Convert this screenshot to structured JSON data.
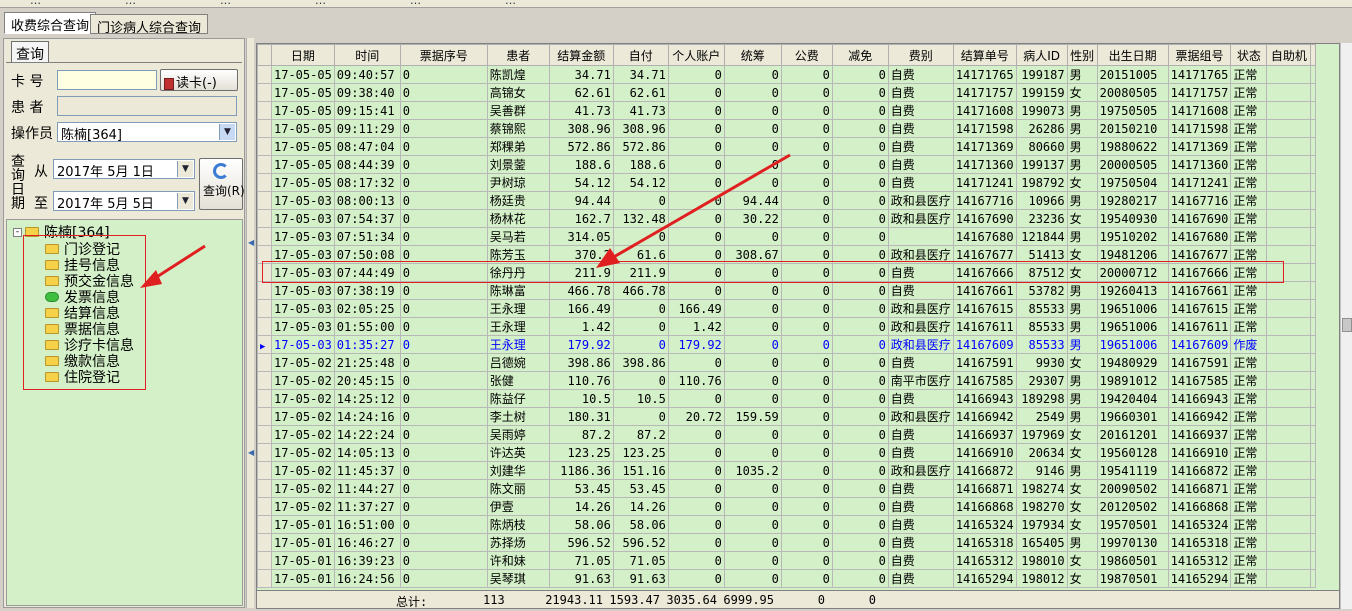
{
  "toolbar": {
    "items": [
      "…",
      "…",
      "…",
      "…",
      "…",
      "…"
    ]
  },
  "tabs": [
    {
      "label": "收费综合查询"
    },
    {
      "label": "门诊病人综合查询"
    }
  ],
  "query_panel": {
    "title": "查询",
    "card_label": "卡  号",
    "card_value": "",
    "read_card_button": "读卡(-)",
    "patient_label": "患  者",
    "patient_value": "",
    "operator_label": "操作员",
    "operator_value": "陈楠[364]",
    "date_label_1": "查询",
    "date_label_2": "日期",
    "from_label": "从",
    "from_date": "2017年 5月 1日",
    "to_label": "至",
    "to_date": "2017年 5月 5日",
    "query_button": "查询(R)"
  },
  "tree": {
    "root": "陈楠[364]",
    "children": [
      "门诊登记",
      "挂号信息",
      "预交金信息",
      "发票信息",
      "结算信息",
      "票据信息",
      "诊疗卡信息",
      "缴款信息",
      "住院登记"
    ]
  },
  "table": {
    "headers": [
      "日期",
      "时间",
      "票据序号",
      "患者",
      "结算金额",
      "自付",
      "个人账户",
      "统筹",
      "公费",
      "减免",
      "费别",
      "结算单号",
      "病人ID",
      "性别",
      "出生日期",
      "票据组号",
      "状态",
      "自助机"
    ],
    "rows": [
      [
        "17-05-05",
        "09:40:57",
        "0",
        "陈凯煌",
        "34.71",
        "34.71",
        "0",
        "0",
        "0",
        "0",
        "自费",
        "14171765",
        "199187",
        "男",
        "20151005",
        "14171765",
        "正常",
        ""
      ],
      [
        "17-05-05",
        "09:38:40",
        "0",
        "高锦女",
        "62.61",
        "62.61",
        "0",
        "0",
        "0",
        "0",
        "自费",
        "14171757",
        "199159",
        "女",
        "20080505",
        "14171757",
        "正常",
        ""
      ],
      [
        "17-05-05",
        "09:15:41",
        "0",
        "吴善群",
        "41.73",
        "41.73",
        "0",
        "0",
        "0",
        "0",
        "自费",
        "14171608",
        "199073",
        "男",
        "19750505",
        "14171608",
        "正常",
        ""
      ],
      [
        "17-05-05",
        "09:11:29",
        "0",
        "蔡锦熙",
        "308.96",
        "308.96",
        "0",
        "0",
        "0",
        "0",
        "自费",
        "14171598",
        "26286",
        "男",
        "20150210",
        "14171598",
        "正常",
        ""
      ],
      [
        "17-05-05",
        "08:47:04",
        "0",
        "郑稞弟",
        "572.86",
        "572.86",
        "0",
        "0",
        "0",
        "0",
        "自费",
        "14171369",
        "80660",
        "男",
        "19880622",
        "14171369",
        "正常",
        ""
      ],
      [
        "17-05-05",
        "08:44:39",
        "0",
        "刘景蓥",
        "188.6",
        "188.6",
        "0",
        "0",
        "0",
        "0",
        "自费",
        "14171360",
        "199137",
        "男",
        "20000505",
        "14171360",
        "正常",
        ""
      ],
      [
        "17-05-05",
        "08:17:32",
        "0",
        "尹树琼",
        "54.12",
        "54.12",
        "0",
        "0",
        "0",
        "0",
        "自费",
        "14171241",
        "198792",
        "女",
        "19750504",
        "14171241",
        "正常",
        ""
      ],
      [
        "17-05-03",
        "08:00:13",
        "0",
        "杨廷贵",
        "94.44",
        "0",
        "0",
        "94.44",
        "0",
        "0",
        "政和县医疗",
        "14167716",
        "10966",
        "男",
        "19280217",
        "14167716",
        "正常",
        ""
      ],
      [
        "17-05-03",
        "07:54:37",
        "0",
        "杨林花",
        "162.7",
        "132.48",
        "0",
        "30.22",
        "0",
        "0",
        "政和县医疗",
        "14167690",
        "23236",
        "女",
        "19540930",
        "14167690",
        "正常",
        ""
      ],
      [
        "17-05-03",
        "07:51:34",
        "0",
        "吴马若",
        "314.05",
        "0",
        "0",
        "0",
        "0",
        "0",
        "",
        "14167680",
        "121844",
        "男",
        "19510202",
        "14167680",
        "正常",
        ""
      ],
      [
        "17-05-03",
        "07:50:08",
        "0",
        "陈芳玉",
        "370.2",
        "61.6",
        "0",
        "308.67",
        "0",
        "0",
        "政和县医疗",
        "14167677",
        "51413",
        "女",
        "19481206",
        "14167677",
        "正常",
        ""
      ],
      [
        "17-05-03",
        "07:44:49",
        "0",
        "徐丹丹",
        "211.9",
        "211.9",
        "0",
        "0",
        "0",
        "0",
        "自费",
        "14167666",
        "87512",
        "女",
        "20000712",
        "14167666",
        "正常",
        ""
      ],
      [
        "17-05-03",
        "07:38:19",
        "0",
        "陈琳富",
        "466.78",
        "466.78",
        "0",
        "0",
        "0",
        "0",
        "自费",
        "14167661",
        "53782",
        "男",
        "19260413",
        "14167661",
        "正常",
        ""
      ],
      [
        "17-05-03",
        "02:05:25",
        "0",
        "王永理",
        "166.49",
        "0",
        "166.49",
        "0",
        "0",
        "0",
        "政和县医疗",
        "14167615",
        "85533",
        "男",
        "19651006",
        "14167615",
        "正常",
        ""
      ],
      [
        "17-05-03",
        "01:55:00",
        "0",
        "王永理",
        "1.42",
        "0",
        "1.42",
        "0",
        "0",
        "0",
        "政和县医疗",
        "14167611",
        "85533",
        "男",
        "19651006",
        "14167611",
        "正常",
        ""
      ],
      [
        "17-05-03",
        "01:35:27",
        "0",
        "王永理",
        "179.92",
        "0",
        "179.92",
        "0",
        "0",
        "0",
        "政和县医疗",
        "14167609",
        "85533",
        "男",
        "19651006",
        "14167609",
        "作废",
        ""
      ],
      [
        "17-05-02",
        "21:25:48",
        "0",
        "吕德婉",
        "398.86",
        "398.86",
        "0",
        "0",
        "0",
        "0",
        "自费",
        "14167591",
        "9930",
        "女",
        "19480929",
        "14167591",
        "正常",
        ""
      ],
      [
        "17-05-02",
        "20:45:15",
        "0",
        "张健",
        "110.76",
        "0",
        "110.76",
        "0",
        "0",
        "0",
        "南平市医疗",
        "14167585",
        "29307",
        "男",
        "19891012",
        "14167585",
        "正常",
        ""
      ],
      [
        "17-05-02",
        "14:25:12",
        "0",
        "陈益仔",
        "10.5",
        "10.5",
        "0",
        "0",
        "0",
        "0",
        "自费",
        "14166943",
        "189298",
        "男",
        "19420404",
        "14166943",
        "正常",
        ""
      ],
      [
        "17-05-02",
        "14:24:16",
        "0",
        "李土树",
        "180.31",
        "0",
        "20.72",
        "159.59",
        "0",
        "0",
        "政和县医疗",
        "14166942",
        "2549",
        "男",
        "19660301",
        "14166942",
        "正常",
        ""
      ],
      [
        "17-05-02",
        "14:22:24",
        "0",
        "吴雨婷",
        "87.2",
        "87.2",
        "0",
        "0",
        "0",
        "0",
        "自费",
        "14166937",
        "197969",
        "女",
        "20161201",
        "14166937",
        "正常",
        ""
      ],
      [
        "17-05-02",
        "14:05:13",
        "0",
        "许达英",
        "123.25",
        "123.25",
        "0",
        "0",
        "0",
        "0",
        "自费",
        "14166910",
        "20634",
        "女",
        "19560128",
        "14166910",
        "正常",
        ""
      ],
      [
        "17-05-02",
        "11:45:37",
        "0",
        "刘建华",
        "1186.36",
        "151.16",
        "0",
        "1035.2",
        "0",
        "0",
        "政和县医疗",
        "14166872",
        "9146",
        "男",
        "19541119",
        "14166872",
        "正常",
        ""
      ],
      [
        "17-05-02",
        "11:44:27",
        "0",
        "陈文丽",
        "53.45",
        "53.45",
        "0",
        "0",
        "0",
        "0",
        "自费",
        "14166871",
        "198274",
        "女",
        "20090502",
        "14166871",
        "正常",
        ""
      ],
      [
        "17-05-02",
        "11:37:27",
        "0",
        "伊壹",
        "14.26",
        "14.26",
        "0",
        "0",
        "0",
        "0",
        "自费",
        "14166868",
        "198270",
        "女",
        "20120502",
        "14166868",
        "正常",
        ""
      ],
      [
        "17-05-01",
        "16:51:00",
        "0",
        "陈炳枝",
        "58.06",
        "58.06",
        "0",
        "0",
        "0",
        "0",
        "自费",
        "14165324",
        "197934",
        "女",
        "19570501",
        "14165324",
        "正常",
        ""
      ],
      [
        "17-05-01",
        "16:46:27",
        "0",
        "苏择炀",
        "596.52",
        "596.52",
        "0",
        "0",
        "0",
        "0",
        "自费",
        "14165318",
        "165405",
        "男",
        "19970130",
        "14165318",
        "正常",
        ""
      ],
      [
        "17-05-01",
        "16:39:23",
        "0",
        "许和妹",
        "71.05",
        "71.05",
        "0",
        "0",
        "0",
        "0",
        "自费",
        "14165312",
        "198010",
        "女",
        "19860501",
        "14165312",
        "正常",
        ""
      ],
      [
        "17-05-01",
        "16:24:56",
        "0",
        "吴琴琪",
        "91.63",
        "91.63",
        "0",
        "0",
        "0",
        "0",
        "自费",
        "14165294",
        "198012",
        "女",
        "19870501",
        "14165294",
        "正常",
        ""
      ]
    ],
    "selected_row": 15,
    "totals": {
      "label": "总计:",
      "count": "113",
      "amount": "21943.11",
      "self_pay": "1593.47",
      "personal": "3035.64",
      "pooled": "6999.95",
      "public": "0",
      "relief": "0"
    }
  },
  "colors": {
    "grid_bg": "#d4f0c8",
    "selected_text": "#0000ff",
    "annotation": "#e02020"
  }
}
